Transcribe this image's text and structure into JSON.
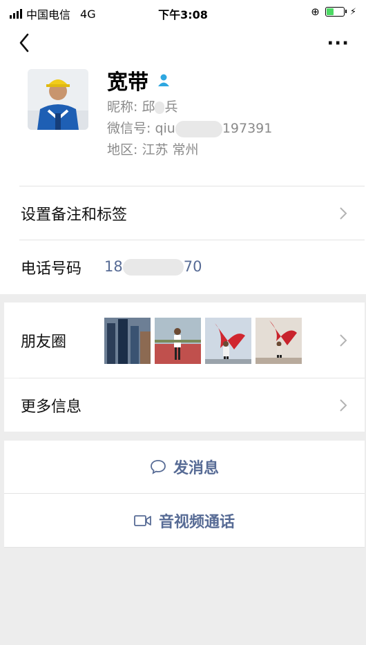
{
  "status_bar": {
    "carrier": "中国电信",
    "network": "4G",
    "time": "下午3:08"
  },
  "nav": {
    "back_icon": "chevron-left-icon",
    "more_label": "···"
  },
  "profile": {
    "name": "宽带",
    "nickname_prefix": "昵称: 邱",
    "nickname_suffix": "兵",
    "wechat_prefix": "微信号: qiu",
    "wechat_suffix": "197391",
    "region": "地区: 江苏 常州"
  },
  "rows": {
    "remark_label": "设置备注和标签",
    "phone_label": "电话号码",
    "phone_prefix": "18",
    "phone_suffix": "70",
    "moments_label": "朋友圈",
    "more_info_label": "更多信息"
  },
  "actions": {
    "message_label": "发消息",
    "video_call_label": "音视频通话"
  },
  "colors": {
    "link": "#576b95",
    "background": "#ededed",
    "verified": "#2ea7e0"
  }
}
